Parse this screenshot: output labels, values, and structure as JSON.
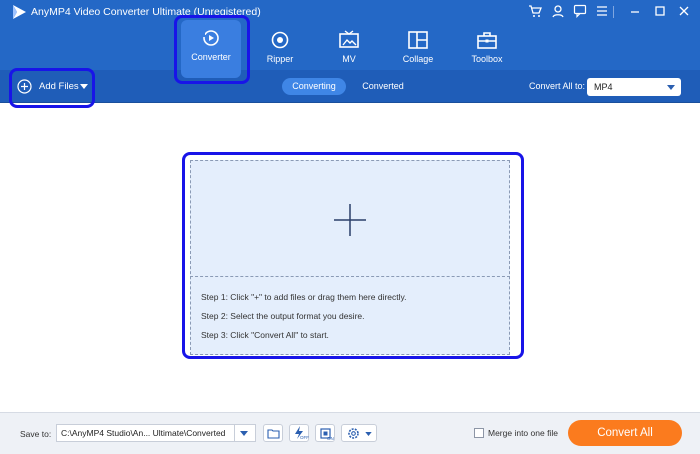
{
  "app": {
    "title": "AnyMP4 Video Converter Ultimate (Unregistered)"
  },
  "nav": {
    "tabs": [
      {
        "label": "Converter",
        "icon": "converter-icon"
      },
      {
        "label": "Ripper",
        "icon": "ripper-icon"
      },
      {
        "label": "MV",
        "icon": "mv-icon"
      },
      {
        "label": "Collage",
        "icon": "collage-icon"
      },
      {
        "label": "Toolbox",
        "icon": "toolbox-icon"
      }
    ]
  },
  "toolbar": {
    "add_files": "Add Files",
    "subtabs": [
      "Converting",
      "Converted"
    ],
    "convert_all_to_label": "Convert All to:",
    "format": "MP4"
  },
  "dropzone": {
    "steps": [
      "Step 1: Click \"+\" to add files or drag them here directly.",
      "Step 2: Select the output format you desire.",
      "Step 3: Click \"Convert All\" to start."
    ]
  },
  "bottom": {
    "save_to_label": "Save to:",
    "save_path": "C:\\AnyMP4 Studio\\An... Ultimate\\Converted",
    "off_label": "OFF",
    "on_label": "ON",
    "merge_label": "Merge into one file",
    "convert_all": "Convert All"
  },
  "colors": {
    "header": "#2468c6",
    "subheader": "#1f5db8",
    "accent": "#fb7b1e",
    "highlight": "#1814e8",
    "dropzone": "#e4eefc"
  }
}
